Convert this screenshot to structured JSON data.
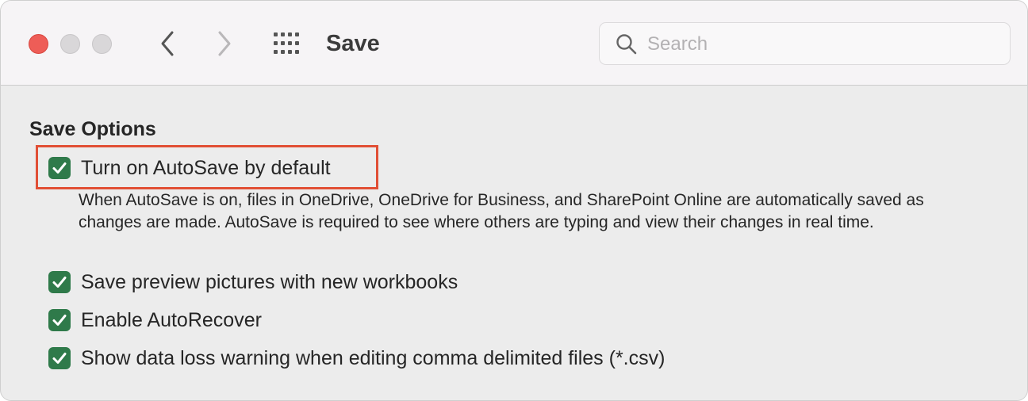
{
  "window": {
    "title": "Save",
    "colors": {
      "close": "#ee5d57",
      "accent_check": "#2f7a4a",
      "highlight": "#e14f35"
    }
  },
  "toolbar": {
    "back_icon": "chevron-left-icon",
    "forward_icon": "chevron-right-icon",
    "grid_icon": "show-all-grid-icon"
  },
  "search": {
    "placeholder": "Search",
    "value": ""
  },
  "section": {
    "heading": "Save Options",
    "options": [
      {
        "label": "Turn on AutoSave by default",
        "checked": true,
        "description": "When AutoSave is on, files in OneDrive, OneDrive for Business, and SharePoint Online are automatically saved as changes are made. AutoSave is required to see where others are typing and view their changes in real time."
      },
      {
        "label": "Save preview pictures with new workbooks",
        "checked": true
      },
      {
        "label": "Enable AutoRecover",
        "checked": true
      },
      {
        "label": "Show data loss warning when editing comma delimited files (*.csv)",
        "checked": true
      }
    ]
  }
}
